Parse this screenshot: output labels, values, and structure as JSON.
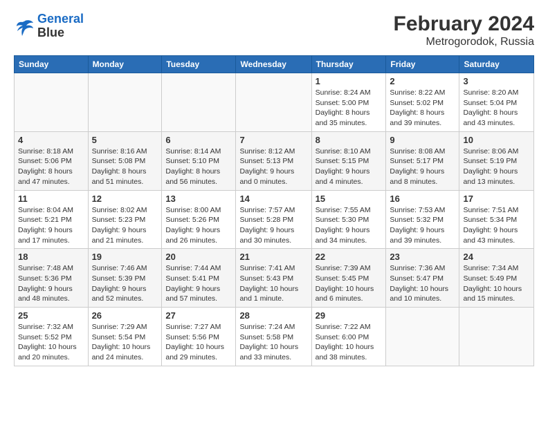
{
  "header": {
    "logo_line1": "General",
    "logo_line2": "Blue",
    "main_title": "February 2024",
    "sub_title": "Metrogorodok, Russia"
  },
  "weekdays": [
    "Sunday",
    "Monday",
    "Tuesday",
    "Wednesday",
    "Thursday",
    "Friday",
    "Saturday"
  ],
  "weeks": [
    [
      {
        "day": "",
        "info": ""
      },
      {
        "day": "",
        "info": ""
      },
      {
        "day": "",
        "info": ""
      },
      {
        "day": "",
        "info": ""
      },
      {
        "day": "1",
        "info": "Sunrise: 8:24 AM\nSunset: 5:00 PM\nDaylight: 8 hours\nand 35 minutes."
      },
      {
        "day": "2",
        "info": "Sunrise: 8:22 AM\nSunset: 5:02 PM\nDaylight: 8 hours\nand 39 minutes."
      },
      {
        "day": "3",
        "info": "Sunrise: 8:20 AM\nSunset: 5:04 PM\nDaylight: 8 hours\nand 43 minutes."
      }
    ],
    [
      {
        "day": "4",
        "info": "Sunrise: 8:18 AM\nSunset: 5:06 PM\nDaylight: 8 hours\nand 47 minutes."
      },
      {
        "day": "5",
        "info": "Sunrise: 8:16 AM\nSunset: 5:08 PM\nDaylight: 8 hours\nand 51 minutes."
      },
      {
        "day": "6",
        "info": "Sunrise: 8:14 AM\nSunset: 5:10 PM\nDaylight: 8 hours\nand 56 minutes."
      },
      {
        "day": "7",
        "info": "Sunrise: 8:12 AM\nSunset: 5:13 PM\nDaylight: 9 hours\nand 0 minutes."
      },
      {
        "day": "8",
        "info": "Sunrise: 8:10 AM\nSunset: 5:15 PM\nDaylight: 9 hours\nand 4 minutes."
      },
      {
        "day": "9",
        "info": "Sunrise: 8:08 AM\nSunset: 5:17 PM\nDaylight: 9 hours\nand 8 minutes."
      },
      {
        "day": "10",
        "info": "Sunrise: 8:06 AM\nSunset: 5:19 PM\nDaylight: 9 hours\nand 13 minutes."
      }
    ],
    [
      {
        "day": "11",
        "info": "Sunrise: 8:04 AM\nSunset: 5:21 PM\nDaylight: 9 hours\nand 17 minutes."
      },
      {
        "day": "12",
        "info": "Sunrise: 8:02 AM\nSunset: 5:23 PM\nDaylight: 9 hours\nand 21 minutes."
      },
      {
        "day": "13",
        "info": "Sunrise: 8:00 AM\nSunset: 5:26 PM\nDaylight: 9 hours\nand 26 minutes."
      },
      {
        "day": "14",
        "info": "Sunrise: 7:57 AM\nSunset: 5:28 PM\nDaylight: 9 hours\nand 30 minutes."
      },
      {
        "day": "15",
        "info": "Sunrise: 7:55 AM\nSunset: 5:30 PM\nDaylight: 9 hours\nand 34 minutes."
      },
      {
        "day": "16",
        "info": "Sunrise: 7:53 AM\nSunset: 5:32 PM\nDaylight: 9 hours\nand 39 minutes."
      },
      {
        "day": "17",
        "info": "Sunrise: 7:51 AM\nSunset: 5:34 PM\nDaylight: 9 hours\nand 43 minutes."
      }
    ],
    [
      {
        "day": "18",
        "info": "Sunrise: 7:48 AM\nSunset: 5:36 PM\nDaylight: 9 hours\nand 48 minutes."
      },
      {
        "day": "19",
        "info": "Sunrise: 7:46 AM\nSunset: 5:39 PM\nDaylight: 9 hours\nand 52 minutes."
      },
      {
        "day": "20",
        "info": "Sunrise: 7:44 AM\nSunset: 5:41 PM\nDaylight: 9 hours\nand 57 minutes."
      },
      {
        "day": "21",
        "info": "Sunrise: 7:41 AM\nSunset: 5:43 PM\nDaylight: 10 hours\nand 1 minute."
      },
      {
        "day": "22",
        "info": "Sunrise: 7:39 AM\nSunset: 5:45 PM\nDaylight: 10 hours\nand 6 minutes."
      },
      {
        "day": "23",
        "info": "Sunrise: 7:36 AM\nSunset: 5:47 PM\nDaylight: 10 hours\nand 10 minutes."
      },
      {
        "day": "24",
        "info": "Sunrise: 7:34 AM\nSunset: 5:49 PM\nDaylight: 10 hours\nand 15 minutes."
      }
    ],
    [
      {
        "day": "25",
        "info": "Sunrise: 7:32 AM\nSunset: 5:52 PM\nDaylight: 10 hours\nand 20 minutes."
      },
      {
        "day": "26",
        "info": "Sunrise: 7:29 AM\nSunset: 5:54 PM\nDaylight: 10 hours\nand 24 minutes."
      },
      {
        "day": "27",
        "info": "Sunrise: 7:27 AM\nSunset: 5:56 PM\nDaylight: 10 hours\nand 29 minutes."
      },
      {
        "day": "28",
        "info": "Sunrise: 7:24 AM\nSunset: 5:58 PM\nDaylight: 10 hours\nand 33 minutes."
      },
      {
        "day": "29",
        "info": "Sunrise: 7:22 AM\nSunset: 6:00 PM\nDaylight: 10 hours\nand 38 minutes."
      },
      {
        "day": "",
        "info": ""
      },
      {
        "day": "",
        "info": ""
      }
    ]
  ]
}
